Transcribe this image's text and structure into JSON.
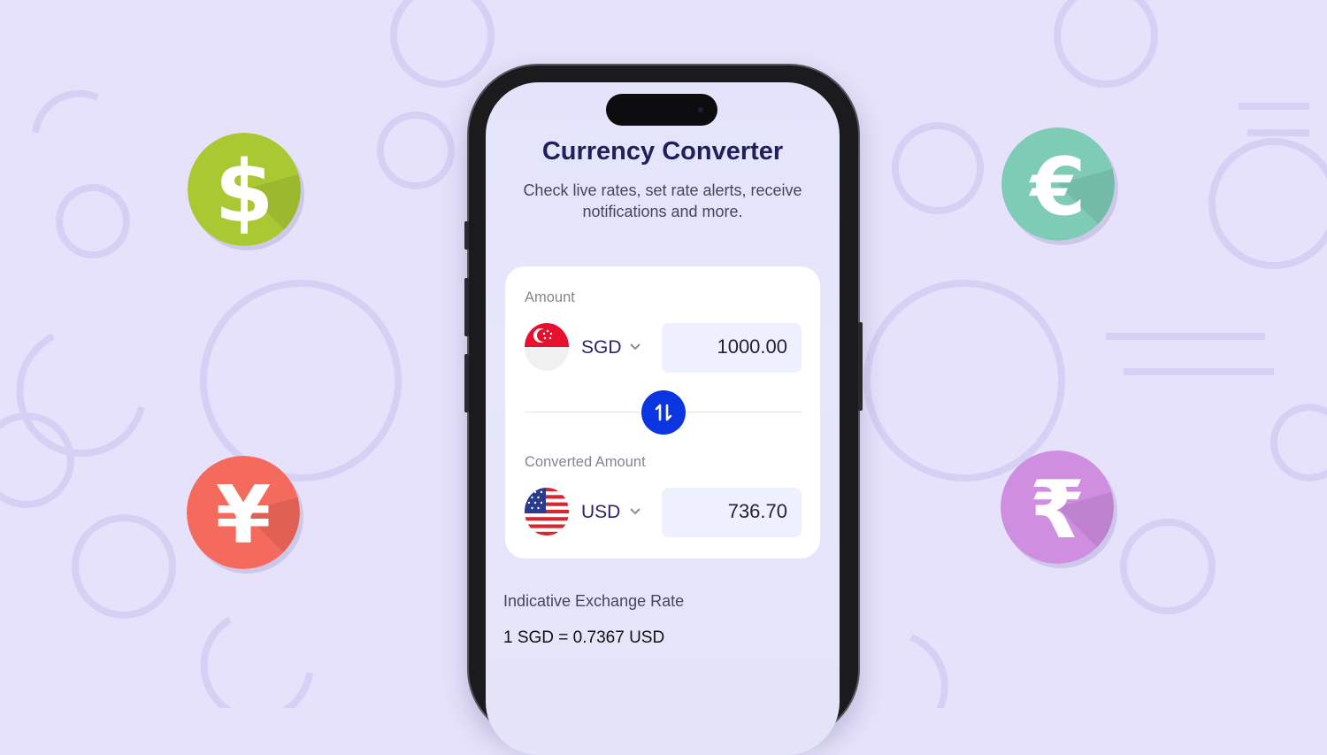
{
  "app": {
    "title": "Currency Converter",
    "subtitle": "Check live rates, set rate alerts, receive notifications and more."
  },
  "converter": {
    "amount_label": "Amount",
    "from": {
      "code": "SGD",
      "amount": "1000.00",
      "flag_icon": "singapore-flag-icon"
    },
    "converted_label": "Converted Amount",
    "to": {
      "code": "USD",
      "amount": "736.70",
      "flag_icon": "usa-flag-icon"
    }
  },
  "rate": {
    "label": "Indicative Exchange Rate",
    "value": "1 SGD = 0.7367 USD"
  },
  "decor": {
    "badges": [
      {
        "icon": "dollar-icon",
        "color": "#a9c832"
      },
      {
        "icon": "euro-icon",
        "color": "#7ecbb6"
      },
      {
        "icon": "yen-icon",
        "color": "#f46a5c"
      },
      {
        "icon": "rupee-icon",
        "color": "#cf8ee0"
      }
    ],
    "colors": {
      "background": "#e6e2fb",
      "accent": "#0a35e0",
      "title": "#1f1f5c"
    }
  }
}
